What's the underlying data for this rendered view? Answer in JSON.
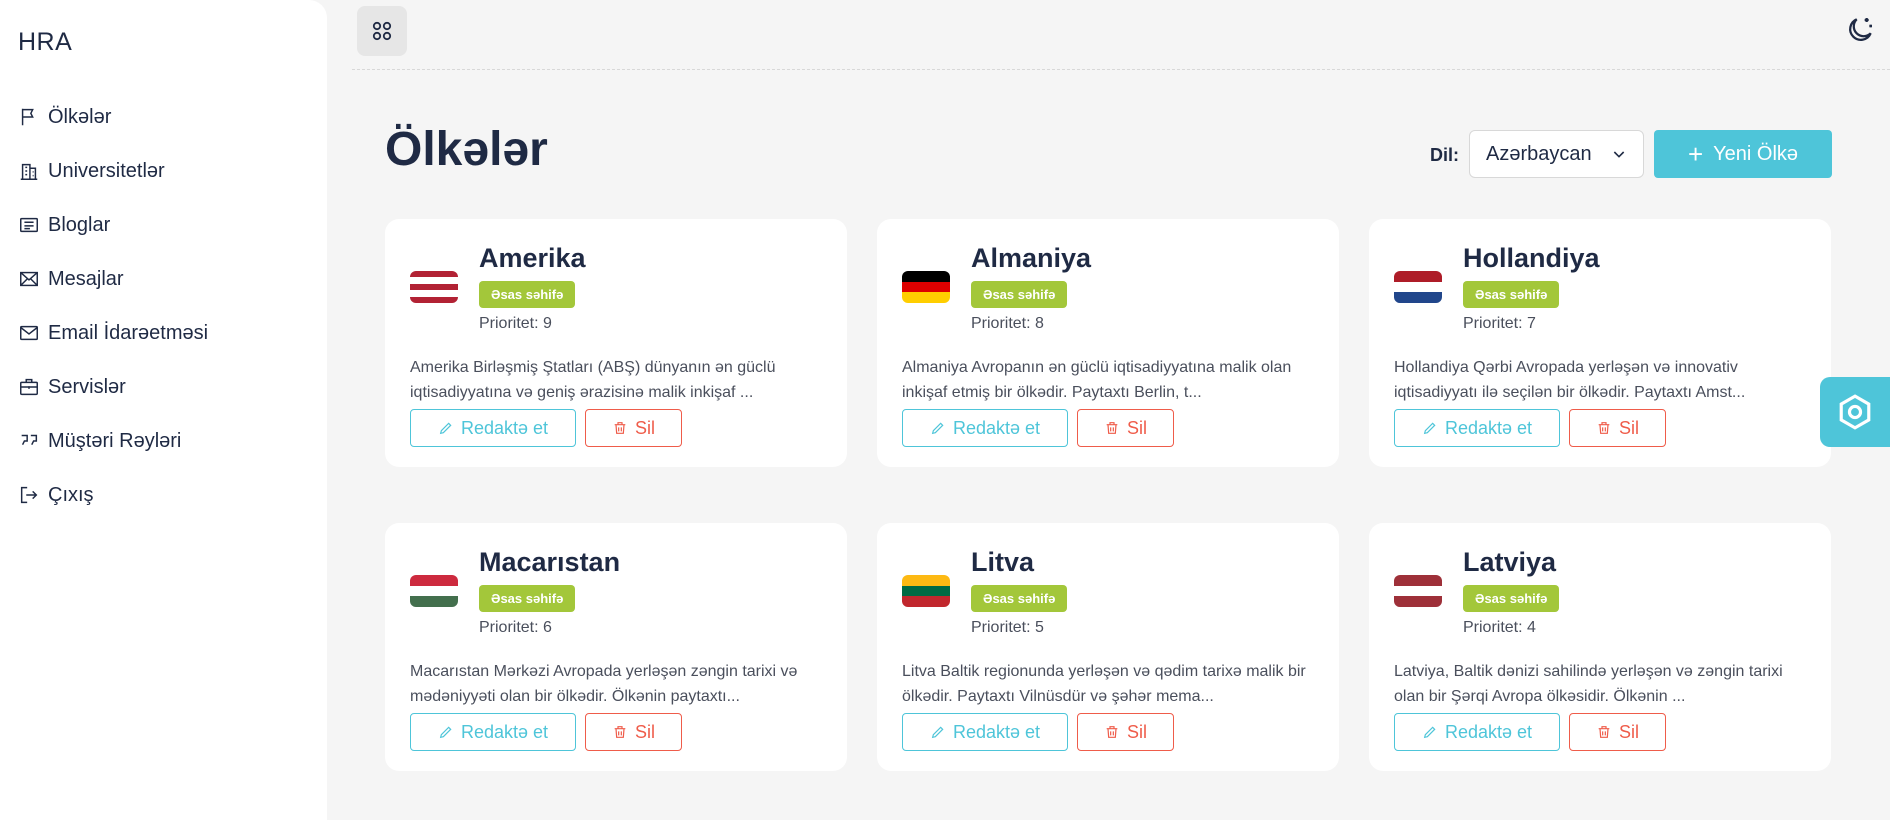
{
  "brand": "HRA",
  "sidebar": {
    "items": [
      {
        "label": "Ölkələr",
        "icon": "flag-icon"
      },
      {
        "label": "Universitetlər",
        "icon": "building-icon"
      },
      {
        "label": "Bloglar",
        "icon": "newspaper-icon"
      },
      {
        "label": "Mesajlar",
        "icon": "envelope-icon"
      },
      {
        "label": "Email İdarəetməsi",
        "icon": "mail-icon"
      },
      {
        "label": "Servislər",
        "icon": "briefcase-icon"
      },
      {
        "label": "Müştəri Rəyləri",
        "icon": "quote-icon"
      },
      {
        "label": "Çıxış",
        "icon": "logout-icon"
      }
    ]
  },
  "header": {
    "title": "Ölkələr",
    "lang_label": "Dil:",
    "lang_value": "Azərbaycan",
    "new_button": "Yeni Ölkə"
  },
  "cards": [
    {
      "name": "Amerika",
      "badge": "Əsas səhifə",
      "priority": "Prioritet: 9",
      "desc": "Amerika Birləşmiş Ştatları (ABŞ) dünyanın ən güclü iqtisadiyyatına və geniş ərazisinə malik inkişaf ...",
      "edit": "Redaktə et",
      "delete": "Sil",
      "flag": [
        "#b22234",
        "#ffffff",
        "#b22234",
        "#ffffff",
        "#b22234"
      ]
    },
    {
      "name": "Almaniya",
      "badge": "Əsas səhifə",
      "priority": "Prioritet: 8",
      "desc": "Almaniya Avropanın ən güclü iqtisadiyyatına malik olan inkişaf etmiş bir ölkədir. Paytaxtı Berlin, t...",
      "edit": "Redaktə et",
      "delete": "Sil",
      "flag": [
        "#000000",
        "#dd0000",
        "#ffce00"
      ]
    },
    {
      "name": "Hollandiya",
      "badge": "Əsas səhifə",
      "priority": "Prioritet: 7",
      "desc": "Hollandiya Qərbi Avropada yerləşən və innovativ iqtisadiyyatı ilə seçilən bir ölkədir. Paytaxtı Amst...",
      "edit": "Redaktə et",
      "delete": "Sil",
      "flag": [
        "#ae1c28",
        "#ffffff",
        "#21468b"
      ]
    },
    {
      "name": "Macarıstan",
      "badge": "Əsas səhifə",
      "priority": "Prioritet: 6",
      "desc": "Macarıstan Mərkəzi Avropada yerləşən zəngin tarixi və mədəniyyəti olan bir ölkədir. Ölkənin paytaxtı...",
      "edit": "Redaktə et",
      "delete": "Sil",
      "flag": [
        "#cd2a3e",
        "#ffffff",
        "#436f4d"
      ]
    },
    {
      "name": "Litva",
      "badge": "Əsas səhifə",
      "priority": "Prioritet: 5",
      "desc": "Litva Baltik regionunda yerləşən və qədim tarixə malik bir ölkədir. Paytaxtı Vilnüsdür və şəhər mema...",
      "edit": "Redaktə et",
      "delete": "Sil",
      "flag": [
        "#fdb913",
        "#006a44",
        "#c1272d"
      ]
    },
    {
      "name": "Latviya",
      "badge": "Əsas səhifə",
      "priority": "Prioritet: 4",
      "desc": "Latviya, Baltik dənizi sahilində yerləşən və zəngin tarixi olan bir Şərqi Avropa ölkəsidir. Ölkənin ...",
      "edit": "Redaktə et",
      "delete": "Sil",
      "flag": [
        "#9e3039",
        "#ffffff",
        "#9e3039"
      ]
    }
  ],
  "colors": {
    "accent": "#4ec5d9",
    "badge": "#a3c73a",
    "danger": "#ef5c4a",
    "title": "#1f2a44"
  }
}
